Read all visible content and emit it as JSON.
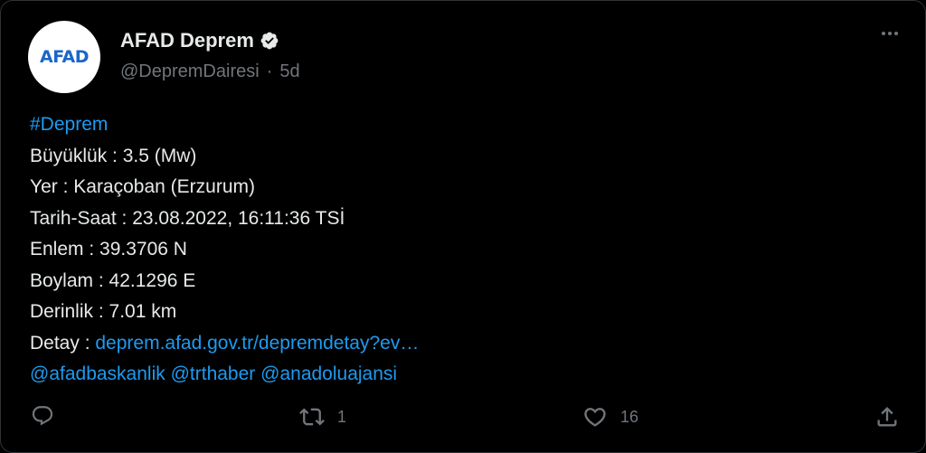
{
  "author": {
    "avatar_text": "AFAD",
    "display_name": "AFAD Deprem",
    "handle": "@DepremDairesi",
    "separator": "·",
    "time": "5d"
  },
  "tweet": {
    "hashtag": "#Deprem",
    "lines": [
      "Büyüklük : 3.5 (Mw)",
      "Yer : Karaçoban (Erzurum)",
      "Tarih-Saat : 23.08.2022, 16:11:36 TSİ",
      "Enlem : 39.3706 N",
      "Boylam : 42.1296 E",
      "Derinlik : 7.01 km"
    ],
    "detail_label": "Detay : ",
    "detail_link": "deprem.afad.gov.tr/depremdetay?ev…",
    "mentions": [
      "@afadbaskanlik",
      "@trthaber",
      "@anadoluajansi"
    ]
  },
  "actions": {
    "reply_count": "",
    "retweet_count": "1",
    "like_count": "16"
  },
  "colors": {
    "background": "#000000",
    "text": "#e7e9ea",
    "muted": "#71767b",
    "link": "#1d9bf0",
    "verified_badge": "#e7e9ea"
  },
  "icons": {
    "verified": "verified-badge-icon",
    "more": "more-dots-icon",
    "reply": "reply-icon",
    "retweet": "retweet-icon",
    "like": "heart-icon",
    "share": "share-icon"
  }
}
